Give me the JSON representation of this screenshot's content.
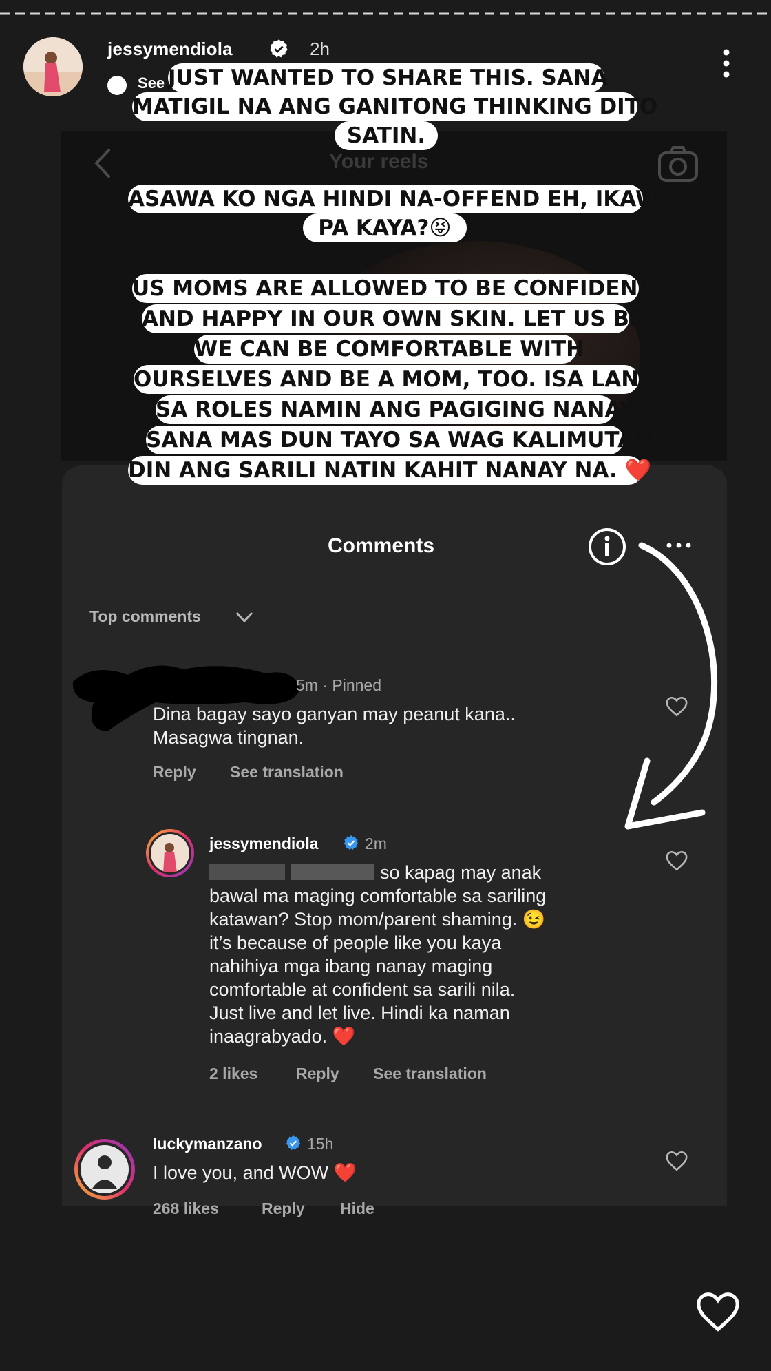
{
  "story": {
    "username": "jessymendiola",
    "time": "2h",
    "see_translation": "See translation"
  },
  "background_post": {
    "title": "Your reels"
  },
  "stickers": {
    "block1": [
      "JUST WANTED TO SHARE THIS. SANA",
      "MATIGIL NA ANG GANITONG THINKING DITO",
      "SATIN."
    ],
    "block2": [
      "ASAWA KO NGA HINDI NA-OFFEND EH, IKAW",
      "PA KAYA?😝"
    ],
    "block3": [
      "US MOMS ARE ALLOWED TO BE CONFIDENT",
      "AND HAPPY IN OUR OWN SKIN. LET US BE.",
      "WE CAN BE COMFORTABLE WITH",
      "OURSELVES AND BE A MOM, TOO. ISA LANG",
      "SA ROLES NAMIN ANG PAGIGING NANAY.",
      "SANA MAS DUN TAYO SA WAG KALIMUTAN",
      "DIN ANG SARILI NATIN KAHIT NANAY NA. ❤️"
    ]
  },
  "comments_sheet": {
    "title": "Comments",
    "filter": "Top comments",
    "comments": [
      {
        "meta": "5m · Pinned",
        "lines": [
          "Dina bagay sayo ganyan may peanut kana..",
          "Masagwa tingnan."
        ],
        "reply": "Reply",
        "translation": "See translation"
      },
      {
        "user": "jessymendiola",
        "time": "2m",
        "lines": [
          "so kapag may anak",
          "bawal ma maging comfortable sa sariling",
          "katawan? Stop mom/parent shaming. 😉",
          "it’s because of people like you kaya",
          "nahihiya mga ibang nanay maging",
          "comfortable at confident sa sarili nila.",
          "Just live and let live. Hindi ka naman",
          "inaagrabyado. ❤️"
        ],
        "likes": "2 likes",
        "reply": "Reply",
        "translation": "See translation"
      },
      {
        "user": "luckymanzano",
        "time": "15h",
        "lines": [
          "I love you, and WOW ❤️"
        ],
        "likes": "268 likes",
        "reply": "Reply",
        "hide": "Hide"
      }
    ]
  },
  "icons": {
    "verified": "verified-badge-icon",
    "more": "more-vertical-icon",
    "info": "info-icon",
    "heart": "heart-icon",
    "chevron": "chevron-down-icon",
    "camera": "camera-icon",
    "back": "back-arrow-icon"
  },
  "colors": {
    "verified": "#3897f0",
    "background": "#1b1b1b",
    "sheet": "#262626"
  }
}
